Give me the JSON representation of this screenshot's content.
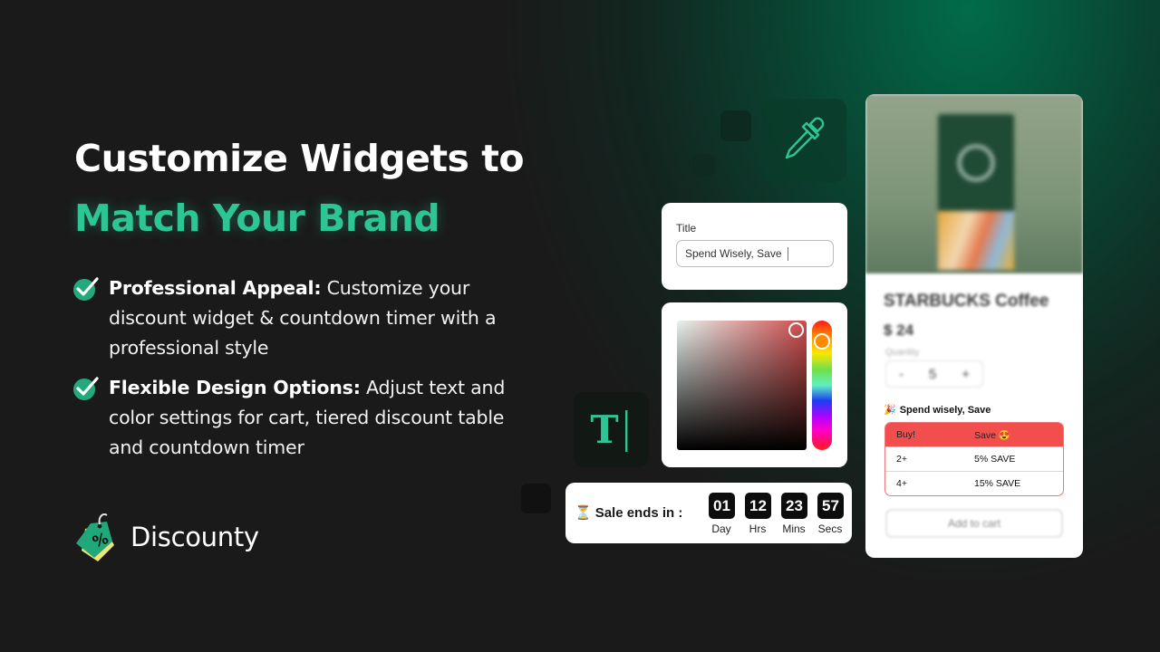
{
  "headline": {
    "line1": "Customize Widgets to",
    "line2": "Match Your Brand"
  },
  "features": [
    {
      "title": "Professional Appeal:",
      "text": " Customize your discount widget & countdown timer with a professional style"
    },
    {
      "title": "Flexible Design Options:",
      "text": " Adjust text and color settings for cart, tiered discount table and countdown timer"
    }
  ],
  "brand": {
    "name": "Discounty",
    "icon": "price-tag-percent-icon"
  },
  "icons": {
    "eyedropper": "eyedropper-icon",
    "text_tool": "text-cursor-icon",
    "check": "check-circle-icon",
    "hourglass": "hourglass-icon"
  },
  "title_editor": {
    "label": "Title",
    "value": "Spend Wisely, Save"
  },
  "color_picker": {
    "selected_color": "#cf4b4b",
    "hue_position": 0.1,
    "saturation": 1.0,
    "brightness": 1.0
  },
  "timer": {
    "icon": "⏳",
    "label": "Sale ends in :",
    "units": [
      {
        "value": "01",
        "label": "Day"
      },
      {
        "value": "12",
        "label": "Hrs"
      },
      {
        "value": "23",
        "label": "Mins"
      },
      {
        "value": "57",
        "label": "Secs"
      }
    ]
  },
  "product": {
    "name": "STARBUCKS Coffee",
    "price": "$ 24",
    "quantity_label": "Quantity",
    "quantity": "5",
    "minus": "-",
    "plus": "+",
    "offer_icon": "🎉",
    "offer_title": "Spend wisely, Save",
    "tier_table": {
      "headers": [
        "Buy!",
        "Save 😍"
      ],
      "rows": [
        [
          "2+",
          "5% SAVE"
        ],
        [
          "4+",
          "15% SAVE"
        ]
      ]
    },
    "add_to_cart": "Add to cart"
  },
  "colors": {
    "background": "#1a1a1a",
    "accent_green": "#2ec595",
    "table_header": "#f24e4e"
  }
}
